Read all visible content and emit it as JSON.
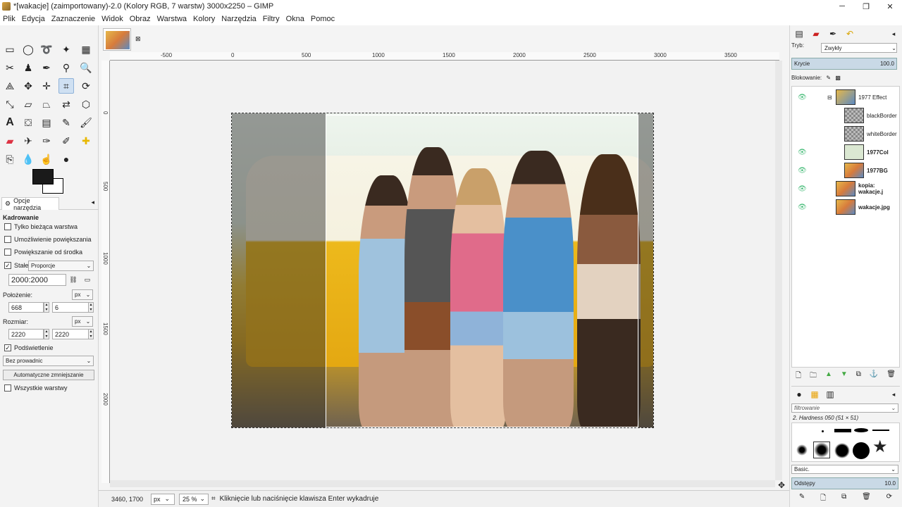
{
  "window": {
    "title": "*[wakacje] (zaimportowany)-2.0 (Kolory RGB, 7 warstw) 3000x2250 – GIMP",
    "controls": [
      "─",
      "❐",
      "✕"
    ]
  },
  "menu": [
    "Plik",
    "Edycja",
    "Zaznaczenie",
    "Widok",
    "Obraz",
    "Warstwa",
    "Kolory",
    "Narzędzia",
    "Filtry",
    "Okna",
    "Pomoc"
  ],
  "tool_options": {
    "tab_label": "Opcje narzędzia",
    "section": "Kadrowanie",
    "current_layer_only": "Tylko bieżąca warstwa",
    "allow_growing": "Umożliwienie powiększania",
    "expand_from_center": "Powiększanie od środka",
    "fixed_label": "Stałe:",
    "fixed_value": "Proporcje",
    "ratio": "2000:2000",
    "position_label": "Położenie:",
    "position_unit": "px",
    "position_x": "668",
    "position_y": "6",
    "size_label": "Rozmiar:",
    "size_unit": "px",
    "size_w": "2220",
    "size_h": "2220",
    "highlight": "Podświetlenie",
    "guides": "Bez prowadnic",
    "auto_shrink": "Automatyczne zmniejszanie",
    "all_layers": "Wszystkie warstwy"
  },
  "ruler": {
    "h_ticks": [
      "-500",
      "0",
      "500",
      "1000",
      "1500",
      "2000",
      "2500",
      "3000",
      "3500"
    ],
    "v_ticks": [
      "0",
      "500",
      "1000",
      "1500",
      "2000"
    ]
  },
  "status": {
    "coords": "3460, 1700",
    "unit": "px",
    "zoom": "25 %",
    "message": "Kliknięcie lub naciśnięcie klawisza Enter wykadruje"
  },
  "layers_panel": {
    "mode_label": "Tryb:",
    "mode_value": "Zwykły",
    "opacity_label": "Krycie",
    "opacity_value": "100.0",
    "lock_label": "Blokowanie:",
    "layers": [
      {
        "name": "1977 Effect",
        "bold": false,
        "visible": true,
        "indent": 1
      },
      {
        "name": "blackBorder",
        "bold": false,
        "visible": false,
        "indent": 2
      },
      {
        "name": "whiteBorder",
        "bold": false,
        "visible": false,
        "indent": 2
      },
      {
        "name": "1977Col",
        "bold": true,
        "visible": true,
        "indent": 2
      },
      {
        "name": "1977BG",
        "bold": true,
        "visible": true,
        "indent": 2
      },
      {
        "name": "kopia: wakacje.j",
        "bold": true,
        "visible": true,
        "indent": 1
      },
      {
        "name": "wakacje.jpg",
        "bold": true,
        "visible": true,
        "indent": 1
      }
    ]
  },
  "brushes_panel": {
    "filter_placeholder": "filtrowanie",
    "brush_name": "2. Hardness 050 (51 × 51)",
    "brush_set": "Basic.",
    "spacing_label": "Odstępy",
    "spacing_value": "10.0"
  }
}
